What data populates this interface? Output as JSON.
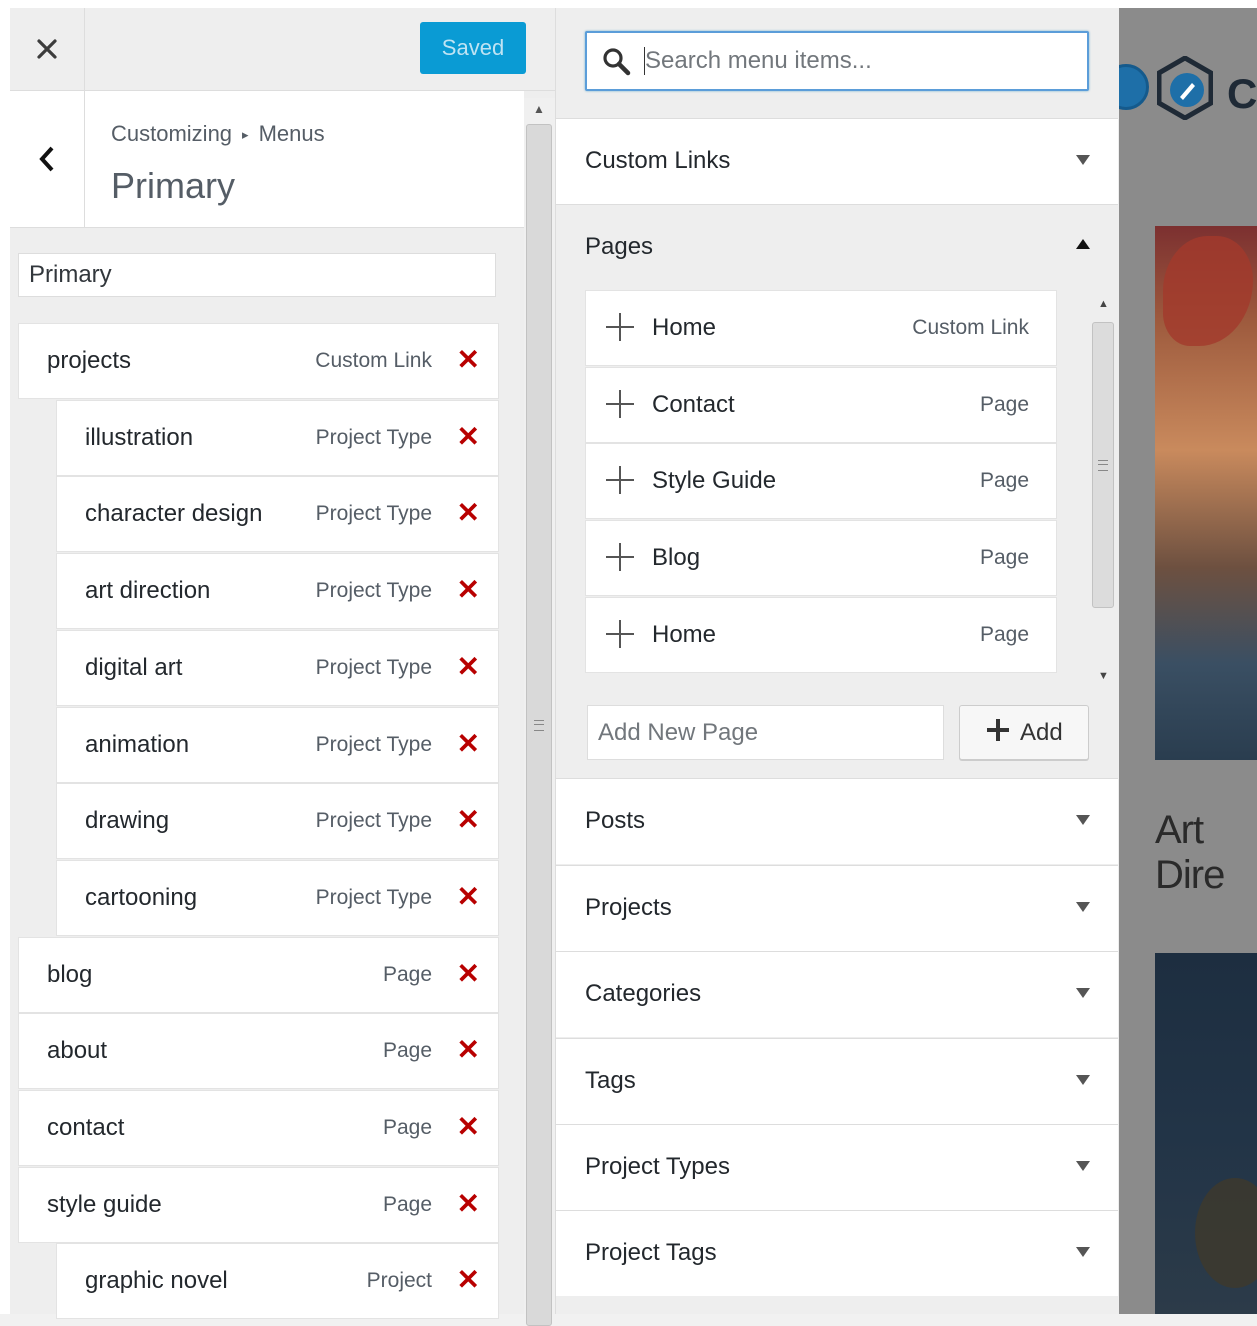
{
  "header": {
    "close_icon": "close-icon",
    "saved_label": "Saved"
  },
  "info": {
    "breadcrumb_root": "Customizing",
    "breadcrumb_section": "Menus",
    "title": "Primary"
  },
  "menu_name": "Primary",
  "menu_items": [
    {
      "label": "projects",
      "type": "Custom Link",
      "level": 0
    },
    {
      "label": "illustration",
      "type": "Project Type",
      "level": 1
    },
    {
      "label": "character design",
      "type": "Project Type",
      "level": 1
    },
    {
      "label": "art direction",
      "type": "Project Type",
      "level": 1
    },
    {
      "label": "digital art",
      "type": "Project Type",
      "level": 1
    },
    {
      "label": "animation",
      "type": "Project Type",
      "level": 1
    },
    {
      "label": "drawing",
      "type": "Project Type",
      "level": 1
    },
    {
      "label": "cartooning",
      "type": "Project Type",
      "level": 1
    },
    {
      "label": "blog",
      "type": "Page",
      "level": 0
    },
    {
      "label": "about",
      "type": "Page",
      "level": 0
    },
    {
      "label": "contact",
      "type": "Page",
      "level": 0
    },
    {
      "label": "style guide",
      "type": "Page",
      "level": 0
    },
    {
      "label": "graphic novel",
      "type": "Project",
      "level": 1
    }
  ],
  "remove_glyph": "✕",
  "search": {
    "placeholder": "Search menu items..."
  },
  "sections": [
    {
      "label": "Custom Links",
      "expanded": false
    },
    {
      "label": "Pages",
      "expanded": true
    },
    {
      "label": "Posts",
      "expanded": false
    },
    {
      "label": "Projects",
      "expanded": false
    },
    {
      "label": "Categories",
      "expanded": false
    },
    {
      "label": "Tags",
      "expanded": false
    },
    {
      "label": "Project Types",
      "expanded": false
    },
    {
      "label": "Project Tags",
      "expanded": false
    }
  ],
  "pages": [
    {
      "label": "Home",
      "type": "Custom Link"
    },
    {
      "label": "Contact",
      "type": "Page"
    },
    {
      "label": "Style Guide",
      "type": "Page"
    },
    {
      "label": "Blog",
      "type": "Page"
    },
    {
      "label": "Home",
      "type": "Page"
    }
  ],
  "add_new_page": {
    "placeholder": "Add New Page",
    "button_label": "Add"
  },
  "preview": {
    "logo_text": "Cl",
    "article_title": "Art Dire"
  },
  "colors": {
    "accent": "#0a9bd4",
    "remove": "#b80000",
    "focus": "#5b9dd9"
  }
}
